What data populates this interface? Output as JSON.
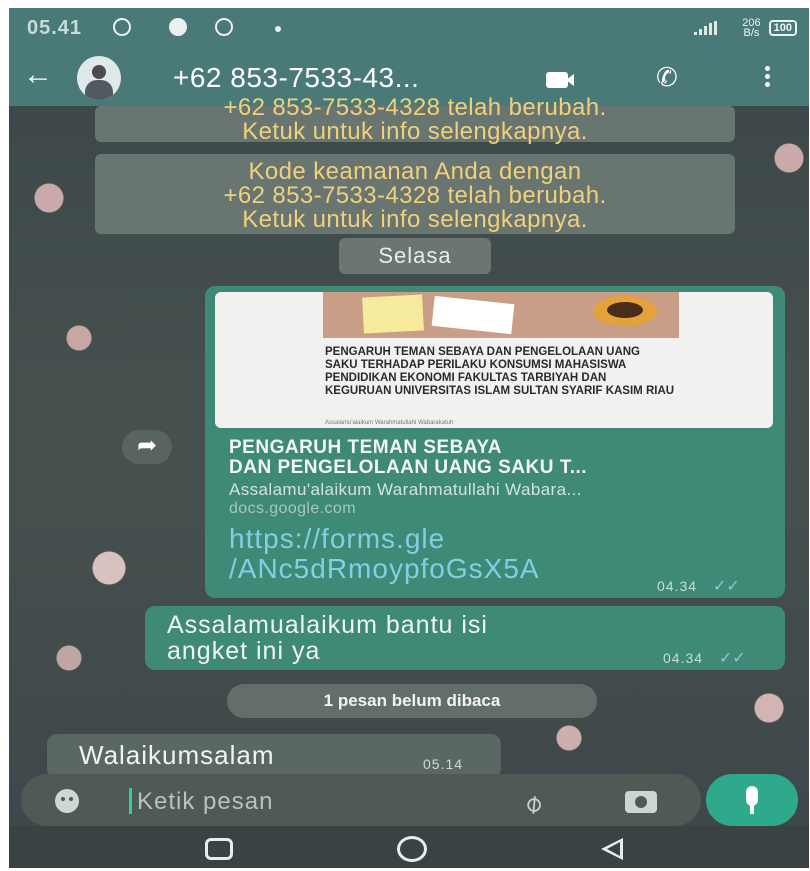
{
  "status_bar": {
    "time": "05.41",
    "network_speed_value": "206",
    "network_speed_unit": "B/s",
    "battery": "100"
  },
  "chat_header": {
    "contact_name": "+62 853-7533-43...",
    "icons": {
      "back": "arrow-left-icon",
      "video": "video-call-icon",
      "call": "phone-icon",
      "menu": "more-vert-icon"
    }
  },
  "system_notices": [
    {
      "line1": "+62 853-7533-4328 telah berubah.",
      "line2": "Ketuk untuk info selengkapnya."
    },
    {
      "line1": "Kode keamanan Anda dengan",
      "line2": "+62 853-7533-4328 telah berubah.",
      "line3": "Ketuk untuk info selengkapnya."
    }
  ],
  "day_separator": "Selasa",
  "messages": [
    {
      "type": "link",
      "direction": "out",
      "preview_doc_title": "PENGARUH TEMAN SEBAYA DAN PENGELOLAAN UANG SAKU TERHADAP PERILAKU KONSUMSI MAHASISWA PENDIDIKAN EKONOMI FAKULTAS TARBIYAH DAN KEGURUAN UNIVERSITAS ISLAM SULTAN SYARIF KASIM RIAU",
      "preview_doc_sub": "Assalamu'alaikum Warahmatullahi Wabarakatuh",
      "link_title_line1": "PENGARUH TEMAN SEBAYA",
      "link_title_line2": "DAN PENGELOLAAN UANG SAKU T...",
      "link_description": "Assalamu'alaikum Warahmatullahi Wabara...",
      "link_domain": "docs.google.com",
      "url_line1": "https://forms.gle",
      "url_line2": "/ANc5dRmoypfoGsX5A",
      "time": "04.34"
    },
    {
      "type": "text",
      "direction": "out",
      "line1": "Assalamualaikum bantu isi",
      "line2": "angket ini ya",
      "time": "04.34"
    },
    {
      "type": "text",
      "direction": "in",
      "text": "Walaikumsalam",
      "time": "05.14"
    }
  ],
  "unread_banner": "1 pesan belum dibaca",
  "composer": {
    "placeholder": "Ketik pesan",
    "icons": {
      "emoji": "emoji-icon",
      "attach": "paperclip-icon",
      "camera": "camera-icon",
      "mic": "mic-icon"
    }
  },
  "colors": {
    "header": "#4a7a78",
    "bubble_out": "#3f8a76",
    "bubble_in": "#5b6764",
    "notice_text": "#f0d07a",
    "link": "#7fd0e2",
    "mic_button": "#2ea98b"
  }
}
